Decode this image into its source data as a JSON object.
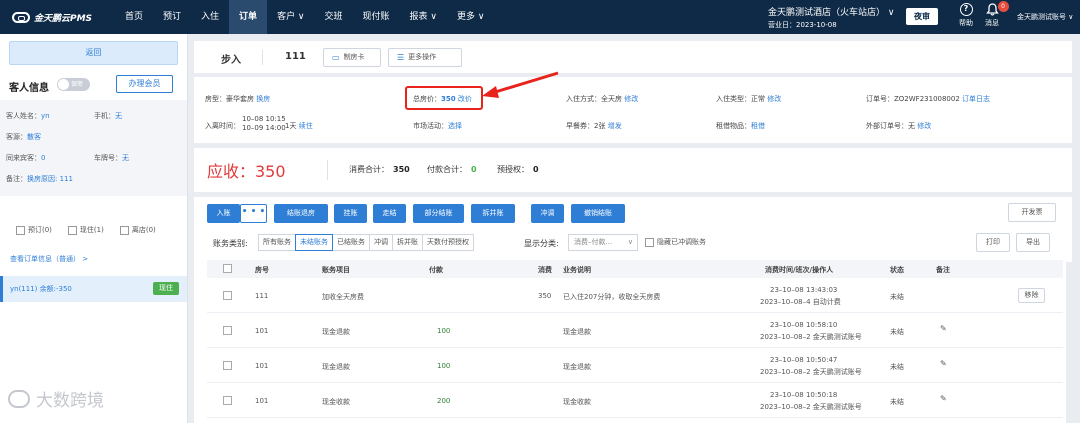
{
  "topbar": {
    "logo": "金天鹏云PMS",
    "nav": [
      "首页",
      "预订",
      "入住",
      "订单",
      "客户 ∨",
      "交班",
      "现付账",
      "报表 ∨",
      "更多 ∨"
    ],
    "active_nav": "订单",
    "hotel_name": "金天鹏测试酒店（火车站店） ∨",
    "business_date": "营业日：2023-10-08",
    "night_audit": "夜审",
    "help": "帮助",
    "help_icon": "?",
    "messages": "消息",
    "message_count": "0",
    "account": "金天鹏测试账号 ∨"
  },
  "sidebar": {
    "back": "返回",
    "guest_info_title": "客人信息",
    "toggle_label": "保密",
    "join_member": "办理会员",
    "guest": {
      "name_label": "客人姓名：",
      "name": "yn",
      "phone_label": "手机：",
      "phone": "无",
      "source_label": "客源：",
      "source": "散客",
      "companions_label": "同来宾客：",
      "companions": "0",
      "plate_label": "车牌号：",
      "plate": "无",
      "remark_label": "备注：",
      "remark": "换房原因: 111"
    },
    "filters": [
      "预订(0)",
      "现住(1)",
      "离店(0)"
    ],
    "view_order": "查看订单信息（普通） >",
    "order_item": "yn(111)  余额:-350",
    "order_status": "现住",
    "watermark": "大数跨境"
  },
  "header": {
    "step": "步入",
    "room": "111",
    "make_card": "制房卡",
    "more_ops": "更多操作"
  },
  "details": {
    "room_type_label": "房型：豪华套房",
    "room_type_action": "换房",
    "total_label": "总房价：",
    "total_value": "350",
    "total_action": "改价",
    "checkin_label": "入住方式：全天房",
    "checkin_action": "修改",
    "checkin_type_label": "入住类型：正常",
    "checkin_type_action": "修改",
    "order_no_label": "订单号：ZO2WF231008002",
    "order_log": "订单日志",
    "stay_label": "入离时间：",
    "stay_in": "10–08 10:15",
    "stay_out": "10–09 14:00",
    "stay_nights": "1天",
    "stay_action": "续住",
    "market_label": "市场活动：",
    "market_action": "选择",
    "breakfast_label": "早餐券：2张",
    "breakfast_action": "增发",
    "rental_label": "租借物品：",
    "rental_action": "租借",
    "external_label": "外部订单号：无",
    "external_action": "修改"
  },
  "summary": {
    "receivable": "应收：350",
    "consume_label": "消费合计：",
    "consume": "350",
    "payment_label": "付款合计：",
    "payment": "0",
    "preauth_label": "预授权：",
    "preauth": "0"
  },
  "actions": {
    "buttons": [
      "入账",
      "结账退房",
      "挂账",
      "走结",
      "部分结账",
      "拆并账",
      "冲调",
      "撤销结账"
    ],
    "more": "• • •",
    "invoice": "开发票",
    "print": "打印",
    "export": "导出"
  },
  "filters": {
    "category_label": "账务类别:",
    "categories": [
      "所有账务",
      "未结账务",
      "已结账务",
      "冲调",
      "拆并账",
      "天数付预授权"
    ],
    "active_category": "未结账务",
    "display_label": "显示分类:",
    "display_value": "消费–付款...",
    "display_caret": "∨",
    "hide_label": "隐藏已冲调账务"
  },
  "table": {
    "headers": [
      "房号",
      "账务项目",
      "付款",
      "消费",
      "业务说明",
      "消费时间/班次/操作人",
      "状态",
      "备注"
    ],
    "rows": [
      {
        "room": "111",
        "item": "加收全天房费",
        "payment": "",
        "consume": "350",
        "desc": "已入住207分钟，收取全天房费",
        "time": "23–10–08 13:43:03",
        "shift": "2023–10–08–4 自动计费",
        "status": "未结",
        "action": "移除"
      },
      {
        "room": "101",
        "item": "现金退款",
        "payment": "100",
        "consume": "",
        "desc": "现金退款",
        "time": "23–10–08 10:58:10",
        "shift": "2023–10–08–2 金天鹏测试账号",
        "status": "未结",
        "action": "✎"
      },
      {
        "room": "101",
        "item": "现金退款",
        "payment": "100",
        "consume": "",
        "desc": "现金退款",
        "time": "23–10–08 10:50:47",
        "shift": "2023–10–08–2 金天鹏测试账号",
        "status": "未结",
        "action": "✎"
      },
      {
        "room": "101",
        "item": "现金收款",
        "payment": "200",
        "consume": "",
        "desc": "现金收款",
        "time": "23–10–08 10:50:18",
        "shift": "2023–10–08–2 金天鹏测试账号",
        "status": "未结",
        "action": "✎"
      }
    ]
  },
  "colors": {
    "nav_bg": "#0e2a47",
    "accent": "#2e7ed6",
    "receivable": "#e03a3a",
    "highlight": "#e8231b",
    "status_green": "#4caf50"
  }
}
